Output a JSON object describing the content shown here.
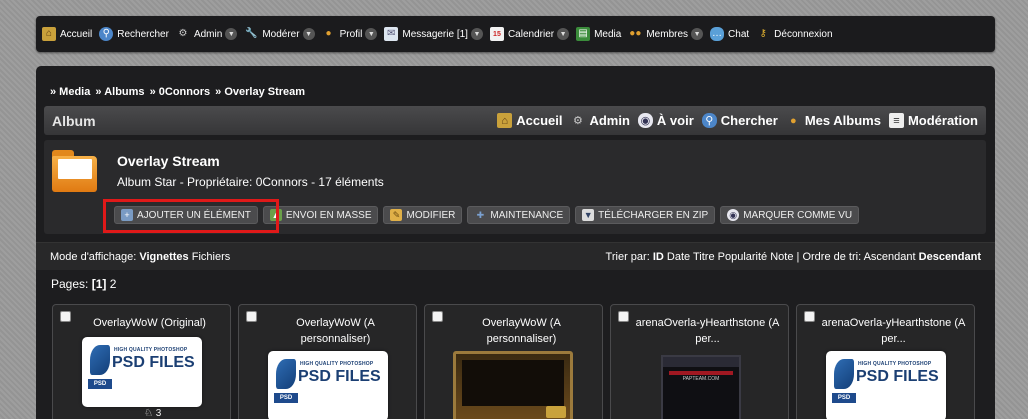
{
  "nav": [
    {
      "label": "Accueil",
      "icon": "house-icon",
      "dropdown": false
    },
    {
      "label": "Rechercher",
      "icon": "magnifier-icon",
      "dropdown": false
    },
    {
      "label": "Admin",
      "icon": "gear-icon",
      "dropdown": true
    },
    {
      "label": "Modérer",
      "icon": "wrench-icon",
      "dropdown": true
    },
    {
      "label": "Profil",
      "icon": "user-icon",
      "dropdown": true
    },
    {
      "label": "Messagerie [1]",
      "icon": "envelope-icon",
      "dropdown": true
    },
    {
      "label": "Calendrier",
      "icon": "calendar-icon",
      "dropdown": true
    },
    {
      "label": "Media",
      "icon": "media-icon",
      "dropdown": false
    },
    {
      "label": "Membres",
      "icon": "members-icon",
      "dropdown": true
    },
    {
      "label": "Chat",
      "icon": "chat-icon",
      "dropdown": false
    },
    {
      "label": "Déconnexion",
      "icon": "key-icon",
      "dropdown": false
    }
  ],
  "breadcrumb": [
    "» Media",
    "» Albums",
    "» 0Connors",
    "» Overlay Stream"
  ],
  "albumbar": {
    "title": "Album",
    "links": [
      {
        "label": "Accueil",
        "icon": "house-icon"
      },
      {
        "label": "Admin",
        "icon": "gear-icon"
      },
      {
        "label": "À voir",
        "icon": "eye-icon"
      },
      {
        "label": "Chercher",
        "icon": "magnifier-icon"
      },
      {
        "label": "Mes Albums",
        "icon": "user-icon"
      },
      {
        "label": "Modération",
        "icon": "list-icon"
      }
    ]
  },
  "album": {
    "name": "Overlay Stream",
    "subtitle": "Album Star - Propriétaire: 0Connors - 17 éléments"
  },
  "actions": [
    {
      "label": "AJOUTER UN ÉLÉMENT",
      "icon": "add-image-icon"
    },
    {
      "label": "ENVOI EN MASSE",
      "icon": "upload-icon"
    },
    {
      "label": "MODIFIER",
      "icon": "folder-edit-icon"
    },
    {
      "label": "MAINTENANCE",
      "icon": "tools-icon"
    },
    {
      "label": "TÉLÉCHARGER EN ZIP",
      "icon": "download-icon"
    },
    {
      "label": "MARQUER COMME VU",
      "icon": "eye-icon"
    }
  ],
  "mode": {
    "label": "Mode d'affichage:",
    "active": "Vignettes",
    "other": "Fichiers"
  },
  "sort": {
    "label": "Trier par:",
    "active": "ID",
    "options": "Date Titre Popularité Note",
    "sep": "|",
    "order_label": "Ordre de tri:",
    "order_other": "Ascendant",
    "order_active": "Descendant"
  },
  "pages": {
    "label": "Pages:",
    "current": "[1]",
    "next": "2"
  },
  "items": [
    {
      "title": "OverlayWoW (Original)",
      "thumb": "psd",
      "rating": "3"
    },
    {
      "title": "OverlayWoW (A personnaliser)",
      "thumb": "psd"
    },
    {
      "title": "OverlayWoW (A personnaliser)",
      "thumb": "game"
    },
    {
      "title": "arenaOverla-yHearthstone (A per...",
      "thumb": "arena"
    },
    {
      "title": "arenaOverla-yHearthstone (A per...",
      "thumb": "psd"
    }
  ],
  "thumb_text": {
    "hq": "HIGH QUALITY PHOTOSHOP",
    "big": "PSD FILES",
    "tag": "PSD",
    "arena": "PAPTEAM.COM"
  },
  "colors": {
    "highlight": "#e01919",
    "panel": "#1d1d1f",
    "nav": "#1b1b1d"
  }
}
